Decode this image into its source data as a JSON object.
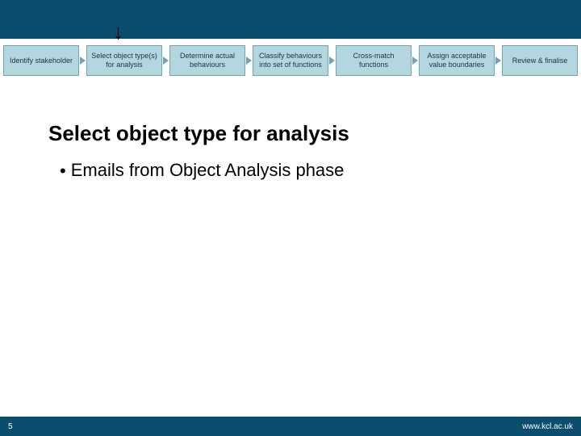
{
  "flow": {
    "steps": [
      "Identify stakeholder",
      "Select object type(s) for analysis",
      "Determine actual behaviours",
      "Classify behaviours into set of functions",
      "Cross-match functions",
      "Assign acceptable value boundaries",
      "Review & finalise"
    ]
  },
  "pointer_glyph": "↓",
  "title": "Select object type for analysis",
  "bullets": [
    "Emails from Object Analysis phase"
  ],
  "footer": {
    "page": "5",
    "url": "www.kcl.ac.uk"
  }
}
